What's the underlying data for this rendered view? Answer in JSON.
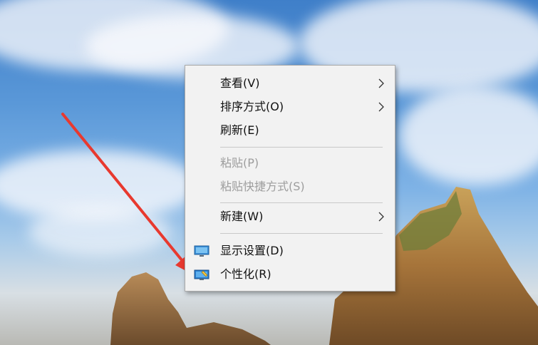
{
  "context_menu": {
    "items": [
      {
        "label": "查看(V)"
      },
      {
        "label": "排序方式(O)"
      },
      {
        "label": "刷新(E)"
      },
      {
        "label": "粘贴(P)"
      },
      {
        "label": "粘贴快捷方式(S)"
      },
      {
        "label": "新建(W)"
      },
      {
        "label": "显示设置(D)",
        "icon": "display-settings-icon"
      },
      {
        "label": "个性化(R)",
        "icon": "personalize-icon"
      }
    ]
  },
  "colors": {
    "menu_bg": "#f2f2f2",
    "disabled_text": "#9d9d9d",
    "annotation_arrow": "#e8392f"
  }
}
